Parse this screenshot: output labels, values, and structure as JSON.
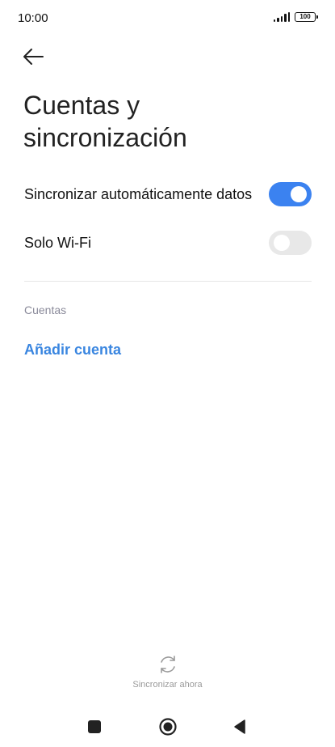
{
  "status_bar": {
    "time": "10:00",
    "battery": "100"
  },
  "header": {
    "back_icon": "arrow-left-icon",
    "title_line1": "Cuentas y",
    "title_line2": "sincronización"
  },
  "settings": {
    "auto_sync": {
      "label": "Sincronizar automáticamente datos",
      "enabled": true
    },
    "wifi_only": {
      "label": "Solo Wi-Fi",
      "enabled": false
    }
  },
  "accounts": {
    "section_title": "Cuentas",
    "add_account_label": "Añadir cuenta"
  },
  "footer": {
    "sync_icon": "sync-icon",
    "sync_now_label": "Sincronizar ahora"
  },
  "nav_bar": {
    "recents_icon": "square-icon",
    "home_icon": "circle-home-icon",
    "back_icon": "triangle-back-icon"
  },
  "colors": {
    "accent": "#3b82f0",
    "link": "#3a86e0",
    "toggle_off": "#e8e8e8",
    "muted_text": "#8a8a9a"
  }
}
